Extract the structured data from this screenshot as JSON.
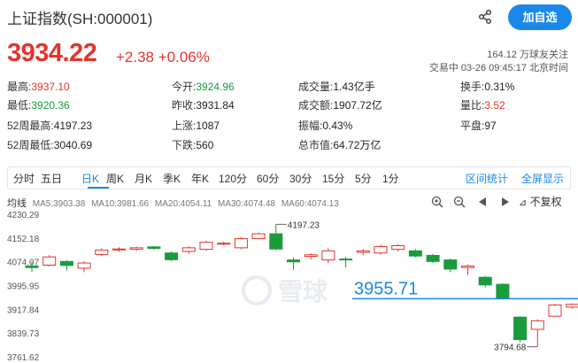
{
  "header": {
    "title": "上证指数(SH:000001)",
    "follow_label": "加自选",
    "share_icon": "share-icon"
  },
  "quote": {
    "price": "3934.22",
    "change": "+2.38 +0.06%",
    "followers": "164.12 万球友关注",
    "timeline": "交易中 03-26 09:45:17 北京时间"
  },
  "stats": [
    [
      {
        "label": "最高:",
        "value": "3937.10",
        "color": "red"
      },
      {
        "label": "今开:",
        "value": "3924.96",
        "color": "green"
      },
      {
        "label": "成交量:",
        "value": "1.43亿手",
        "color": ""
      },
      {
        "label": "换手:",
        "value": "0.31%",
        "color": ""
      }
    ],
    [
      {
        "label": "最低:",
        "value": "3920.36",
        "color": "green"
      },
      {
        "label": "昨收:",
        "value": "3931.84",
        "color": ""
      },
      {
        "label": "成交额:",
        "value": "1907.72亿",
        "color": ""
      },
      {
        "label": "量比:",
        "value": "3.52",
        "color": "red"
      }
    ],
    [
      {
        "label": "52周最高:",
        "value": "4197.23",
        "color": ""
      },
      {
        "label": "上涨:",
        "value": "1087",
        "color": ""
      },
      {
        "label": "振幅:",
        "value": "0.43%",
        "color": ""
      },
      {
        "label": "平盘:",
        "value": "97",
        "color": ""
      }
    ],
    [
      {
        "label": "52周最低:",
        "value": "3040.69",
        "color": ""
      },
      {
        "label": "下跌:",
        "value": "560",
        "color": ""
      },
      {
        "label": "总市值:",
        "value": "64.72万亿",
        "color": ""
      },
      {
        "label": "",
        "value": "",
        "color": ""
      }
    ]
  ],
  "tabs": [
    "分时",
    "五日",
    "日K",
    "周K",
    "月K",
    "季K",
    "年K",
    "120分",
    "60分",
    "30分",
    "15分",
    "5分",
    "1分"
  ],
  "active_tab": "日K",
  "tab_right": [
    "区间统计",
    "全屏显示"
  ],
  "ma": {
    "label": "均线",
    "ma5": "MA5:3903.38",
    "ma10": "MA10:3981.66",
    "ma20": "MA20:4054.11",
    "ma30": "MA30:4074.48",
    "ma60": "MA60:4074.13"
  },
  "adjust_label": "不复权",
  "toolbar_icons": [
    "zoom-in-icon",
    "zoom-out-icon",
    "scroll-left-icon",
    "scroll-right-icon"
  ],
  "watermark": "雪球",
  "colors": {
    "up": "#e4342c",
    "down": "#1a9b3c",
    "accent": "#1a88e8"
  },
  "chart_data": {
    "type": "candlestick",
    "y_ticks": [
      "4230.29",
      "4152.18",
      "4074.07",
      "3995.95",
      "3917.84",
      "3839.73",
      "3761.62"
    ],
    "ylim": [
      3761.62,
      4230.29
    ],
    "candles": [
      {
        "o": 4060,
        "c": 4055,
        "h": 4075,
        "l": 4040
      },
      {
        "o": 4063,
        "c": 4090,
        "h": 4096,
        "l": 4058
      },
      {
        "o": 4075,
        "c": 4062,
        "h": 4080,
        "l": 4045
      },
      {
        "o": 4053,
        "c": 4070,
        "h": 4076,
        "l": 4040
      },
      {
        "o": 4098,
        "c": 4113,
        "h": 4118,
        "l": 4093
      },
      {
        "o": 4114,
        "c": 4116,
        "h": 4122,
        "l": 4108
      },
      {
        "o": 4115,
        "c": 4120,
        "h": 4124,
        "l": 4110
      },
      {
        "o": 4123,
        "c": 4118,
        "h": 4126,
        "l": 4114
      },
      {
        "o": 4103,
        "c": 4081,
        "h": 4108,
        "l": 4076
      },
      {
        "o": 4108,
        "c": 4120,
        "h": 4125,
        "l": 4100
      },
      {
        "o": 4115,
        "c": 4138,
        "h": 4143,
        "l": 4110
      },
      {
        "o": 4132,
        "c": 4135,
        "h": 4140,
        "l": 4128
      },
      {
        "o": 4120,
        "c": 4150,
        "h": 4155,
        "l": 4115
      },
      {
        "o": 4150,
        "c": 4166,
        "h": 4170,
        "l": 4148
      },
      {
        "o": 4166,
        "c": 4116,
        "h": 4197.23,
        "l": 4112
      },
      {
        "o": 4080,
        "c": 4074,
        "h": 4088,
        "l": 4048
      },
      {
        "o": 4092,
        "c": 4097,
        "h": 4102,
        "l": 4082
      },
      {
        "o": 4080,
        "c": 4110,
        "h": 4118,
        "l": 4070
      },
      {
        "o": 4083,
        "c": 4081,
        "h": 4090,
        "l": 4055
      },
      {
        "o": 4105,
        "c": 4110,
        "h": 4115,
        "l": 4095
      },
      {
        "o": 4103,
        "c": 4124,
        "h": 4130,
        "l": 4097
      },
      {
        "o": 4115,
        "c": 4127,
        "h": 4132,
        "l": 4108
      },
      {
        "o": 4110,
        "c": 4093,
        "h": 4116,
        "l": 4088
      },
      {
        "o": 4095,
        "c": 4075,
        "h": 4100,
        "l": 4070
      },
      {
        "o": 4080,
        "c": 4050,
        "h": 4085,
        "l": 4040
      },
      {
        "o": 4055,
        "c": 4060,
        "h": 4065,
        "l": 4030
      },
      {
        "o": 4023,
        "c": 3998,
        "h": 4028,
        "l": 3990
      },
      {
        "o": 4000,
        "c": 3955,
        "h": 4003,
        "l": 3950
      },
      {
        "o": 3892,
        "c": 3818,
        "h": 3895,
        "l": 3810
      },
      {
        "o": 3852,
        "c": 3880,
        "h": 3885,
        "l": 3794.68
      },
      {
        "o": 3895,
        "c": 3932,
        "h": 3936,
        "l": 3893
      },
      {
        "o": 3924.96,
        "c": 3934.22,
        "h": 3937.1,
        "l": 3920.36
      }
    ],
    "annotations": [
      {
        "text": "4197.23",
        "candle": 14,
        "value": 4197.23,
        "side": "right"
      },
      {
        "text": "3794.68",
        "candle": 29,
        "value": 3794.68,
        "side": "left"
      }
    ],
    "price_line": {
      "value": 3955.71,
      "label": "3955.71"
    }
  }
}
